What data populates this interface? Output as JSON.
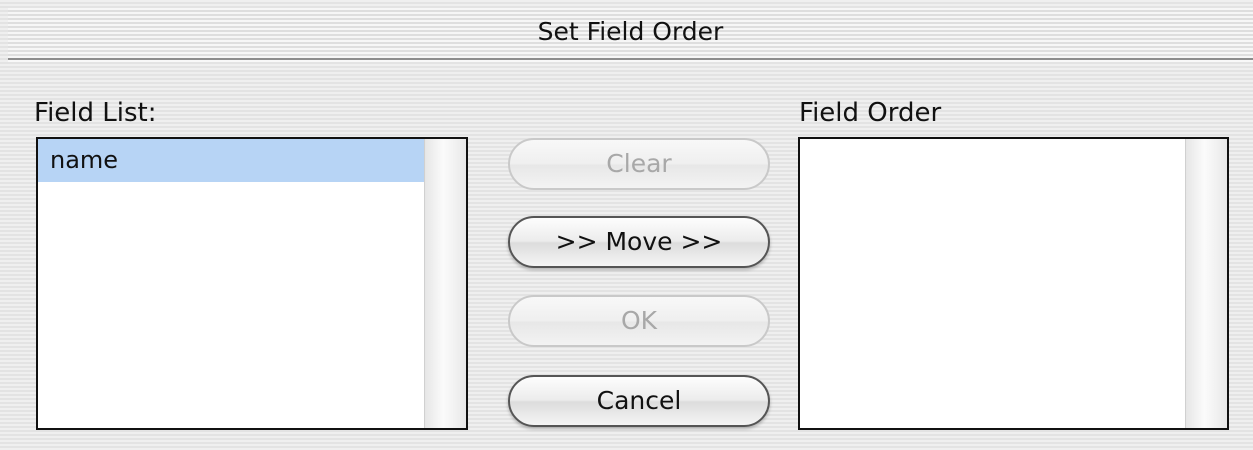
{
  "window": {
    "title": "Set Field Order"
  },
  "field_list": {
    "label": "Field List:",
    "items": [
      {
        "label": "name",
        "selected": true
      }
    ]
  },
  "field_order": {
    "label": "Field Order",
    "items": []
  },
  "buttons": {
    "clear": {
      "label": "Clear",
      "enabled": false
    },
    "move": {
      "label": ">> Move >>",
      "enabled": true
    },
    "ok": {
      "label": "OK",
      "enabled": false
    },
    "cancel": {
      "label": "Cancel",
      "enabled": true
    }
  },
  "colors": {
    "selection": "#b7d4f5",
    "disabled_text": "#a8a8a8",
    "enabled_text": "#111111"
  }
}
